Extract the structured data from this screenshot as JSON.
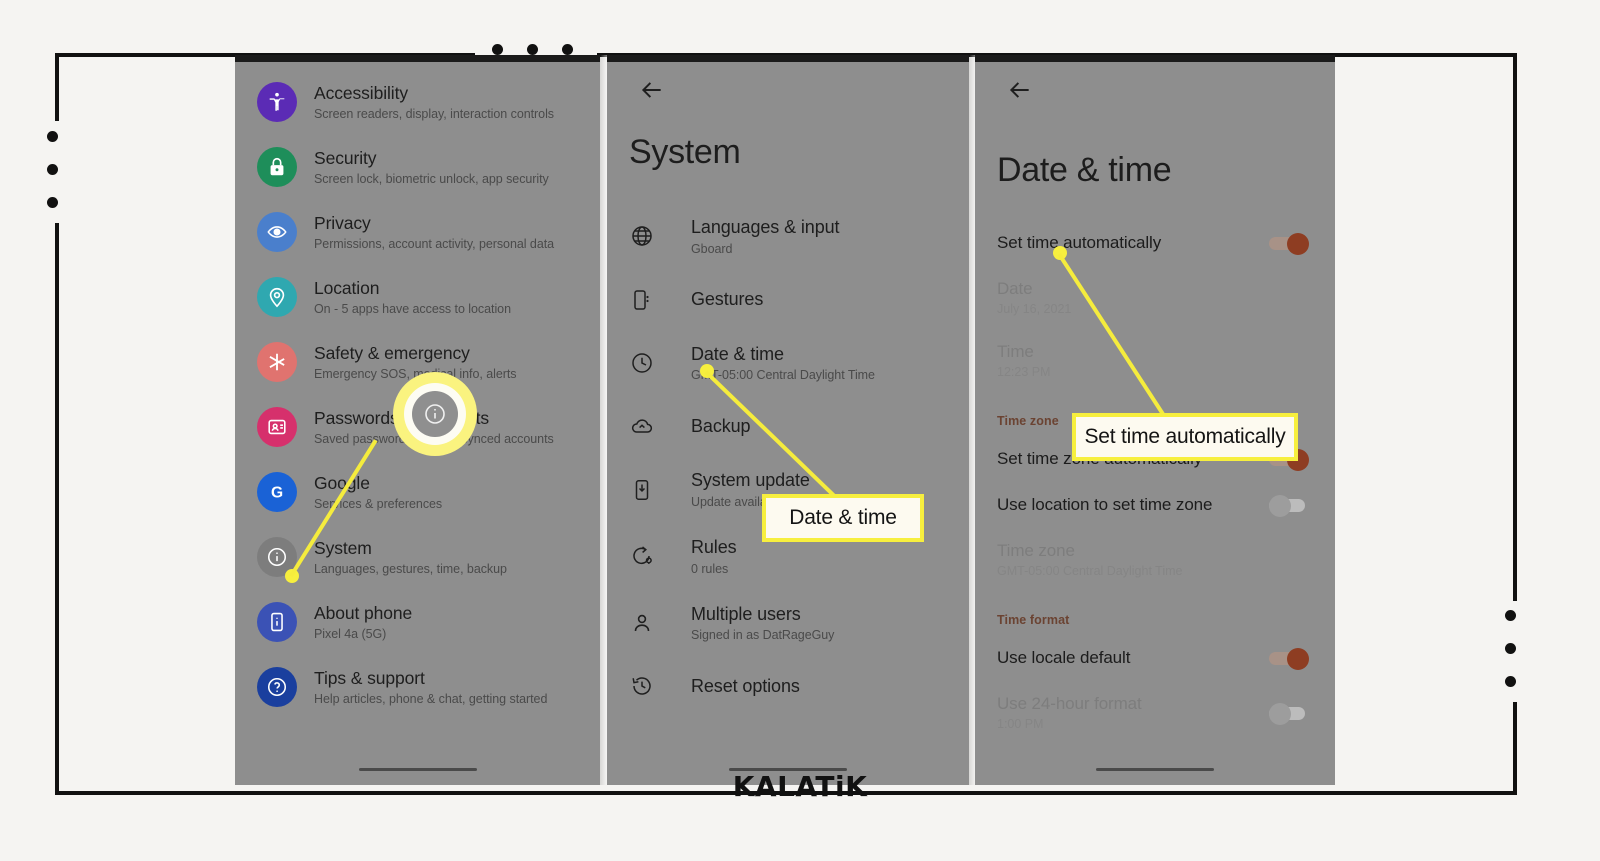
{
  "watermark": "KALATiK",
  "panel1": {
    "name": "settings-list",
    "items": [
      {
        "title": "Accessibility",
        "subtitle": "Screen readers, display, interaction controls",
        "icon": "accessibility-icon",
        "color": "#5b2bb5"
      },
      {
        "title": "Security",
        "subtitle": "Screen lock, biometric unlock, app security",
        "icon": "lock-icon",
        "color": "#1e8e5a"
      },
      {
        "title": "Privacy",
        "subtitle": "Permissions, account activity, personal data",
        "icon": "eye-icon",
        "color": "#4a7fcc"
      },
      {
        "title": "Location",
        "subtitle": "On - 5 apps have access to location",
        "icon": "pin-icon",
        "color": "#2fa8b0"
      },
      {
        "title": "Safety & emergency",
        "subtitle": "Emergency SOS, medical info, alerts",
        "icon": "asterisk-icon",
        "color": "#e0736f"
      },
      {
        "title": "Passwords & accounts",
        "subtitle": "Saved passwords, autofill, synced accounts",
        "icon": "password-card-icon",
        "color": "#d6306c"
      },
      {
        "title": "Google",
        "subtitle": "Services & preferences",
        "icon": "google-g-icon",
        "color": "#1a62d6"
      },
      {
        "title": "System",
        "subtitle": "Languages, gestures, time, backup",
        "icon": "info-icon",
        "color": "#7d7d7d"
      },
      {
        "title": "About phone",
        "subtitle": "Pixel 4a (5G)",
        "icon": "phone-info-icon",
        "color": "#3b52b5"
      },
      {
        "title": "Tips & support",
        "subtitle": "Help articles, phone & chat, getting started",
        "icon": "question-icon",
        "color": "#1a3f9e"
      }
    ],
    "tap_target_icon": "info-icon"
  },
  "panel2": {
    "back_icon": "back-arrow-icon",
    "title": "System",
    "items": [
      {
        "title": "Languages & input",
        "subtitle": "Gboard",
        "icon": "globe-icon"
      },
      {
        "title": "Gestures",
        "subtitle": "",
        "icon": "gesture-phone-icon"
      },
      {
        "title": "Date & time",
        "subtitle": "GMT-05:00 Central Daylight Time",
        "icon": "clock-icon"
      },
      {
        "title": "Backup",
        "subtitle": "",
        "icon": "cloud-upload-icon"
      },
      {
        "title": "System update",
        "subtitle": "Update available",
        "icon": "system-update-icon"
      },
      {
        "title": "Rules",
        "subtitle": "0 rules",
        "icon": "rules-icon"
      },
      {
        "title": "Multiple users",
        "subtitle": "Signed in as DatRageGuy",
        "icon": "person-icon"
      },
      {
        "title": "Reset options",
        "subtitle": "",
        "icon": "history-reset-icon"
      }
    ],
    "callout_label": "Date & time"
  },
  "panel3": {
    "back_icon": "back-arrow-icon",
    "title": "Date & time",
    "rows": [
      {
        "kind": "toggle",
        "label": "Set time automatically",
        "state": "on",
        "dim": false
      },
      {
        "kind": "value",
        "label": "Date",
        "value": "July 16, 2021",
        "dim": true
      },
      {
        "kind": "value",
        "label": "Time",
        "value": "12:23 PM",
        "dim": true
      },
      {
        "kind": "section",
        "label": "Time zone"
      },
      {
        "kind": "toggle",
        "label": "Set time zone automatically",
        "state": "on",
        "dim": false
      },
      {
        "kind": "toggle",
        "label": "Use location to set time zone",
        "state": "off",
        "dim": false
      },
      {
        "kind": "value",
        "label": "Time zone",
        "value": "GMT-05:00 Central Daylight Time",
        "dim": true
      },
      {
        "kind": "section",
        "label": "Time format"
      },
      {
        "kind": "toggle",
        "label": "Use locale default",
        "state": "on",
        "dim": false
      },
      {
        "kind": "toggle-value",
        "label": "Use 24-hour format",
        "value": "1:00 PM",
        "state": "off",
        "dim": true
      }
    ],
    "callout_label": "Set time automatically"
  },
  "colors": {
    "highlight_yellow": "#f7ef3e",
    "callout_fill": "#fdfaf0",
    "panel_bg": "#8e8e8e",
    "page_bg": "#f5f4f2",
    "toggle_on": "#8e3d22",
    "toggle_off": "#9d9d9d",
    "section_heading": "#6b4332"
  }
}
